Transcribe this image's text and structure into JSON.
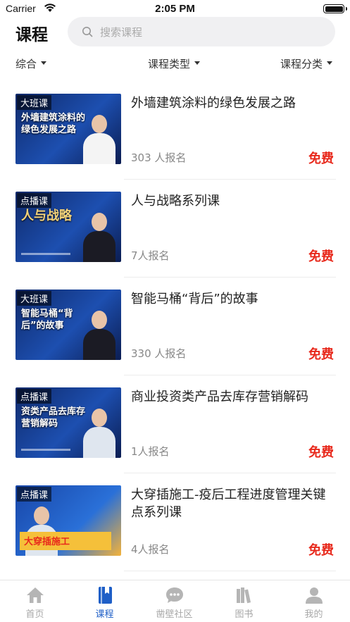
{
  "status_bar": {
    "carrier": "Carrier",
    "time": "2:05 PM"
  },
  "header": {
    "title": "课程",
    "search_placeholder": "搜索课程"
  },
  "filters": [
    {
      "label": "综合"
    },
    {
      "label": "课程类型"
    },
    {
      "label": "课程分类"
    }
  ],
  "courses": [
    {
      "badge": "大班课",
      "thumb_text": "外墙建筑涂料的绿色发展之路",
      "title": "外墙建筑涂料的绿色发展之路",
      "count": "303 人报名",
      "price": "免费"
    },
    {
      "badge": "点播课",
      "thumb_text": "人与战略",
      "title": "人与战略系列课",
      "count": "7人报名",
      "price": "免费"
    },
    {
      "badge": "大班课",
      "thumb_text": "智能马桶“背后”的故事",
      "title": "智能马桶“背后”的故事",
      "count": "330 人报名",
      "price": "免费"
    },
    {
      "badge": "点播课",
      "thumb_text": "资类产品去库存营销解码",
      "title": "商业投资类产品去库存营销解码",
      "count": "1人报名",
      "price": "免费"
    },
    {
      "badge": "点播课",
      "thumb_text": "大穿插施工",
      "title": "大穿插施工-疫后工程进度管理关键点系列课",
      "count": "4人报名",
      "price": "免费"
    }
  ],
  "tabbar": [
    {
      "label": "首页",
      "icon": "home-icon",
      "active": false
    },
    {
      "label": "课程",
      "icon": "book-icon",
      "active": true
    },
    {
      "label": "凿壁社区",
      "icon": "chat-icon",
      "active": false
    },
    {
      "label": "图书",
      "icon": "books-icon",
      "active": false
    },
    {
      "label": "我的",
      "icon": "user-icon",
      "active": false
    }
  ],
  "colors": {
    "accent": "#1f5fc7",
    "price": "#e8291c",
    "inactive": "#a8a8a8"
  }
}
